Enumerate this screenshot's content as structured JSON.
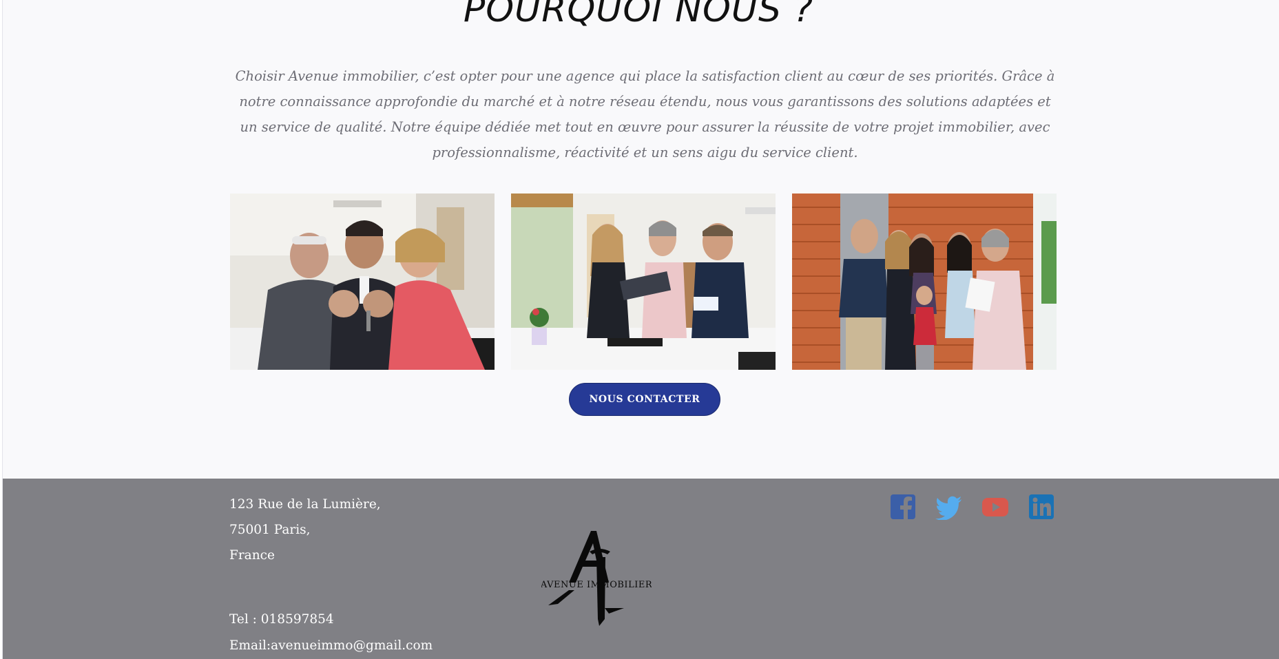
{
  "section": {
    "title": "POURQUOI NOUS ?",
    "intro": "Choisir Avenue immobilier, c’est opter pour une agence qui place la satisfaction client au cœur de ses priorités. Grâce à notre connaissance approfondie du marché et à notre réseau étendu, nous vous garantissons des solutions adaptées et un service de qualité. Notre équipe dédiée met tout en œuvre pour assurer la réussite de votre projet immobilier, avec professionnalisme, réactivité et un sens aigu du service client."
  },
  "gallery": [
    {
      "icon": "photo-seniors-with-agent-keys"
    },
    {
      "icon": "photo-agents-meeting-in-kitchen"
    },
    {
      "icon": "photo-family-handing-keys"
    }
  ],
  "cta": {
    "label": "NOUS CONTACTER"
  },
  "footer": {
    "address_line1": "123 Rue de la Lumière,",
    "address_line2": "75001 Paris,",
    "address_line3": "France",
    "phone": "Tel : 018597854",
    "email": "Email:avenueimmo@gmail.com",
    "logo_text": "AVENUE IMMOBILIER",
    "social": [
      {
        "icon": "facebook-icon",
        "color": "#3b5fa8"
      },
      {
        "icon": "twitter-icon",
        "color": "#55acee"
      },
      {
        "icon": "youtube-icon",
        "color": "#d9584d"
      },
      {
        "icon": "linkedin-icon",
        "color": "#1a72b5"
      }
    ]
  },
  "colors": {
    "accent": "#263a96",
    "footer_bg": "#808085",
    "page_bg": "#f9f9fb"
  }
}
